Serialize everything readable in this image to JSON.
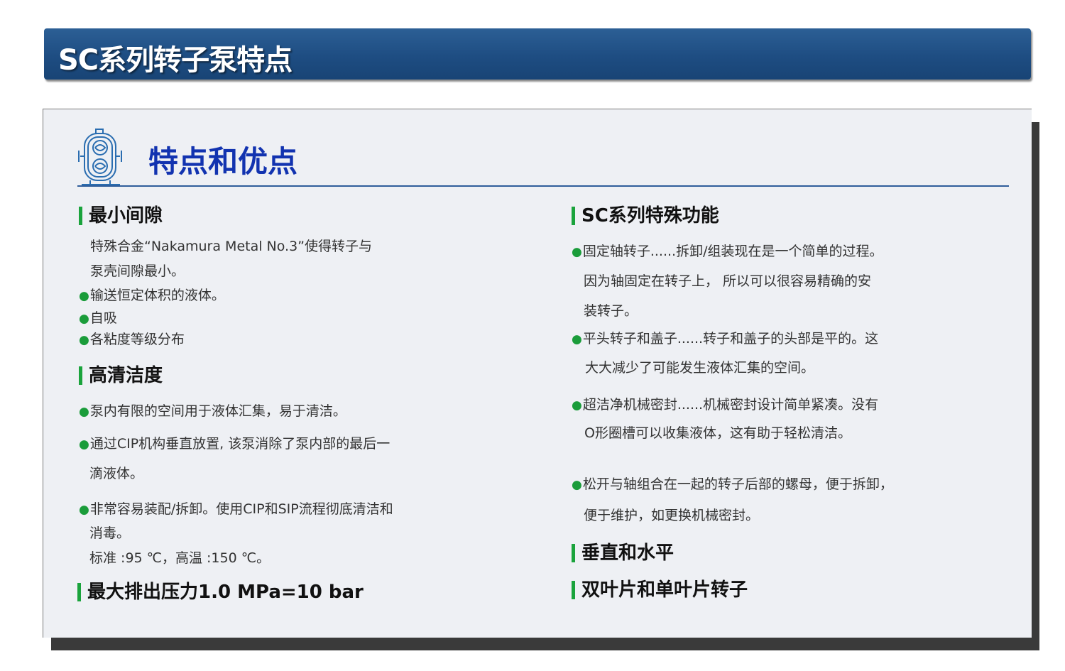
{
  "banner": {
    "title": "SC系列转子泵特点"
  },
  "section": {
    "title": "特点和优点",
    "icon": "lobe-pump-icon"
  },
  "left": {
    "h1": "最小间隙",
    "l1a": "特殊合金“Nakamura Metal No.3”使得转子与",
    "l1b": "泵壳间隙最小。",
    "b1": "输送恒定体积的液体。",
    "b2": "自吸",
    "b3": "各粘度等级分布",
    "h2": "高清洁度",
    "b4": "泵内有限的空间用于液体汇集，易于清洁。",
    "b5a": "通过CIP机构垂直放置, 该泵消除了泵内部的最后一",
    "b5b": "滴液体。",
    "b6a": "非常容易装配/拆卸。使用CIP和SIP流程彻底清洁和",
    "b6b": "消毒。",
    "b6c": "标准 :95 ℃，高温 :150 ℃。",
    "h3": "最大排出压力1.0 MPa=10 bar"
  },
  "right": {
    "h1": "SC系列特殊功能",
    "r1a": "固定轴转子......拆卸/组装现在是一个简单的过程。",
    "r1b": "因为轴固定在转子上， 所以可以很容易精确的安",
    "r1c": "装转子。",
    "r2a": "平头转子和盖子......转子和盖子的头部是平的。这",
    "r2b": "大大减少了可能发生液体汇集的空间。",
    "r3a": "超洁净机械密封......机械密封设计简单紧凑。没有",
    "r3b": "O形圈槽可以收集液体，这有助于轻松清洁。",
    "r4a": "松开与轴组合在一起的转子后部的螺母，便于拆卸，",
    "r4b": "便于维护，如更换机械密封。",
    "h2": "垂直和水平",
    "h3": "双叶片和单叶片转子"
  },
  "colors": {
    "banner": "#1e4d82",
    "title_blue": "#1233b0",
    "accent_green": "#1aa33c"
  }
}
